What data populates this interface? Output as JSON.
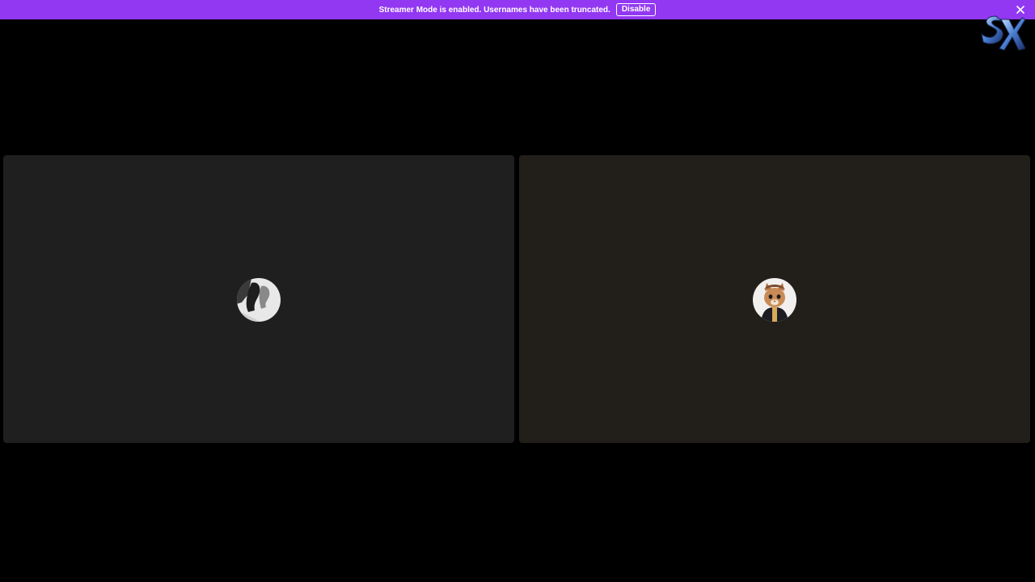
{
  "banner": {
    "message": "Streamer Mode is enabled. Usernames have been truncated.",
    "disable_label": "Disable",
    "close_icon": "close-icon",
    "color": "#9238f2"
  },
  "overlay": {
    "logo_icon": "sk-logo-icon"
  },
  "participants": [
    {
      "avatar_icon": "avatar-bw-photo",
      "tile_color": "#1f1f1f"
    },
    {
      "avatar_icon": "avatar-cat-photo",
      "tile_color": "#221e19"
    }
  ]
}
